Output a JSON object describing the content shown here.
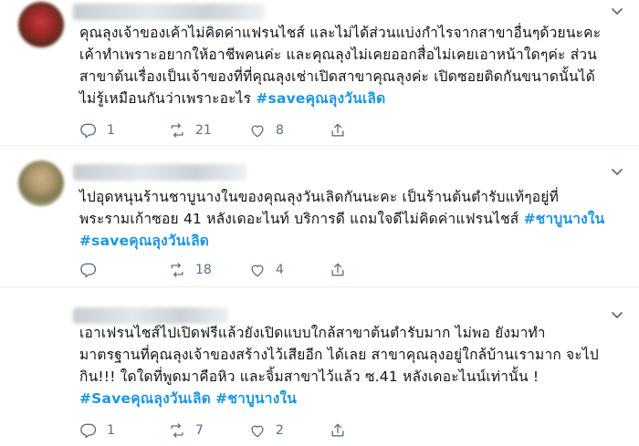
{
  "tweets": [
    {
      "body": [
        "คุณลุงเจ้าของเค้าไม่คิดค่าแฟรนไชส์ และไม่ได้ส่วนแบ่งกำไรจากสาขาอื่นๆด้วยนะคะ",
        "เค้าทำเพราะอยากให้อาชีพคนค่ะ และคุณลุงไม่เคยออกสื่อไม่เคยเอาหน้าใดๆค่ะ ส่วน",
        "สาขาต้นเรื่องเป็นเจ้าของที่ที่คุณลุงเช่าเปิดสาขาคุณลุงค่ะ เปิดซอยติดกันขนาดนั้นได้",
        "ไม่รู้เหมือนกันว่าเพราะอะไร "
      ],
      "tags": [
        "#saveคุณลุงวันเลิด"
      ],
      "reply_count": "1",
      "retweet_count": "21",
      "like_count": "8"
    },
    {
      "body": [
        "ไปอุดหนุนร้านชาบูนางในของคุณลุงวันเลิดกันนะคะ เป็นร้านต้นตำรับแท้ๆอยู่ที่",
        "พระรามเก้าซอย 41 หลังเดอะไนท์ บริการดี แถมใจดีไม่คิดค่าแฟรนไชส์ "
      ],
      "tags": [
        "#ชาบูนางใน",
        "#saveคุณลุงวันเลิด"
      ],
      "reply_count": "",
      "retweet_count": "18",
      "like_count": "4"
    },
    {
      "body": [
        "เอาเฟรนไชส์ไปเปิดฟรีแล้วยังเปิดแบบใกล้สาขาต้นตำรับมาก ไม่พอ ยังมาทำ",
        "มาตรฐานที่คุณลุงเจ้าของสร้างไว้เสียอีก ได้เลย สาขาคุณลุงอยู่ใกล้บ้านเรามาก จะไป",
        "กิน!!! ใดใดที่พูดมาคือหิว และจิ้มสาขาไว้แล้ว ซ.41 หลังเดอะไนน์เท่านั้น !"
      ],
      "tags": [
        "#Saveคุณลุงวันเลิด",
        "#ชาบูนางใน"
      ],
      "reply_count": "1",
      "retweet_count": "7",
      "like_count": "2"
    }
  ],
  "colors": {
    "hashtag": "#1b95e0",
    "icon": "#5b7083",
    "divider": "#e6ecf0"
  },
  "icons": [
    "reply-icon",
    "retweet-icon",
    "like-icon",
    "share-icon",
    "chevron-down-icon"
  ]
}
